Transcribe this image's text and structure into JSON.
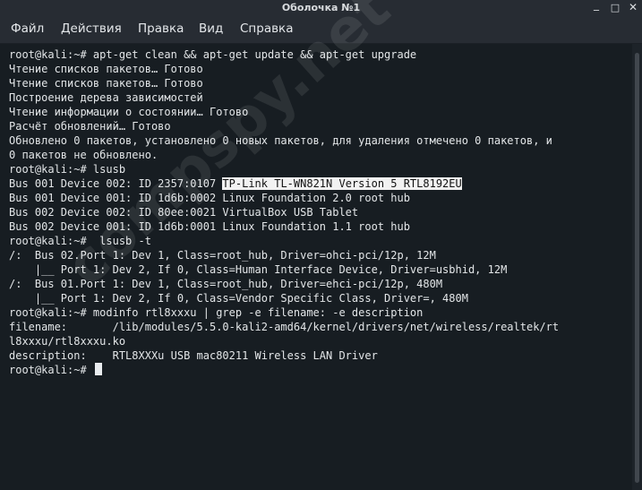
{
  "window": {
    "title": "Оболочка №1",
    "controls": {
      "minimize": "_",
      "maximize": "□",
      "close": "✕"
    }
  },
  "menu": {
    "items": [
      "Файл",
      "Действия",
      "Правка",
      "Вид",
      "Справка"
    ]
  },
  "terminal": {
    "lines": [
      "root@kali:~# apt-get clean && apt-get update && apt-get upgrade",
      "Чтение списков пакетов… Готово",
      "Чтение списков пакетов… Готово",
      "Построение дерева зависимостей",
      "Чтение информации о состоянии… Готово",
      "Расчёт обновлений… Готово",
      "Обновлено 0 пакетов, установлено 0 новых пакетов, для удаления отмечено 0 пакетов, и",
      "0 пакетов не обновлено.",
      "root@kali:~# lsusb",
      {
        "prefix": "Bus 001 Device 002: ID 2357:0107 ",
        "highlight": "TP-Link TL-WN821N Version 5 RTL8192EU"
      },
      "Bus 001 Device 001: ID 1d6b:0002 Linux Foundation 2.0 root hub",
      "Bus 002 Device 002: ID 80ee:0021 VirtualBox USB Tablet",
      "Bus 002 Device 001: ID 1d6b:0001 Linux Foundation 1.1 root hub",
      "root@kali:~#  lsusb -t",
      "/:  Bus 02.Port 1: Dev 1, Class=root_hub, Driver=ohci-pci/12p, 12M",
      "    |__ Port 1: Dev 2, If 0, Class=Human Interface Device, Driver=usbhid, 12M",
      "/:  Bus 01.Port 1: Dev 1, Class=root_hub, Driver=ehci-pci/12p, 480M",
      "    |__ Port 1: Dev 2, If 0, Class=Vendor Specific Class, Driver=, 480M",
      "root@kali:~# modinfo rtl8xxxu | grep -e filename: -e description",
      "filename:       /lib/modules/5.5.0-kali2-amd64/kernel/drivers/net/wireless/realtek/rt",
      "l8xxxu/rtl8xxxu.ko",
      "description:    RTL8XXXu USB mac80211 Wireless LAN Driver",
      "root@kali:~# "
    ]
  },
  "watermark": "compspy.net",
  "colors": {
    "titlebar": "#272c33",
    "terminal_bg": "#171d22",
    "terminal_fg": "#e3e6e8",
    "highlight_bg": "#f2f2f2"
  }
}
